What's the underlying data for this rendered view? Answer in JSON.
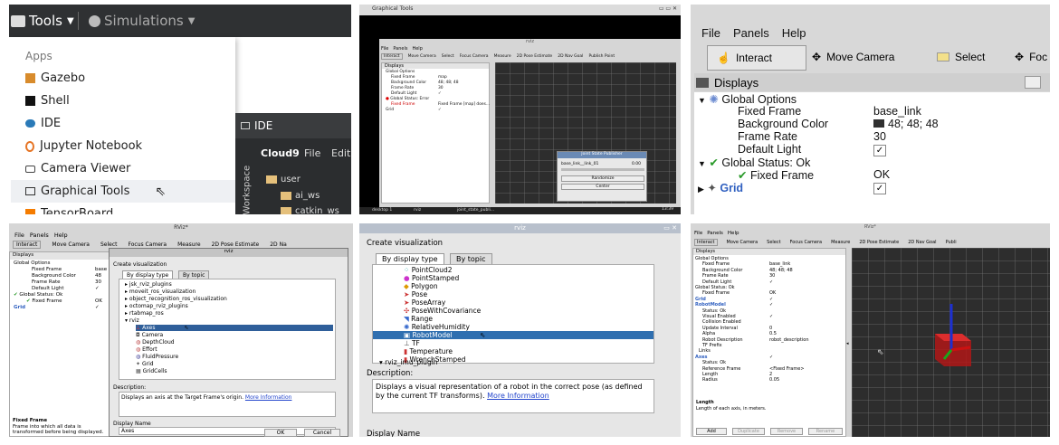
{
  "p1": {
    "tools_label": "Tools",
    "simulations_label": "Simulations",
    "apps_heading": "Apps",
    "menu_items": [
      "Gazebo",
      "Shell",
      "IDE",
      "Jupyter Notebook",
      "Camera Viewer",
      "Graphical Tools",
      "TensorBoard"
    ],
    "ide_title": "IDE",
    "cloud9_label": "Cloud9",
    "file_label": "File",
    "edit_label": "Edit",
    "workspace_label": "Workspace",
    "folders": [
      "user",
      "ai_ws",
      "catkin_ws"
    ]
  },
  "p2": {
    "window_title": "Graphical Tools",
    "rviz_title": "rviz",
    "menu": [
      "File",
      "Panels",
      "Help"
    ],
    "toolbar": [
      "Interact",
      "Move Camera",
      "Select",
      "Focus Camera",
      "Measure",
      "2D Pose Estimate",
      "2D Nav Goal",
      "Publish Point"
    ],
    "displays_label": "Displays",
    "tree": [
      {
        "label": "Global Options",
        "value": ""
      },
      {
        "label": "Fixed Frame",
        "value": "map"
      },
      {
        "label": "Background Color",
        "value": "48; 48; 48"
      },
      {
        "label": "Frame Rate",
        "value": "30"
      },
      {
        "label": "Default Light",
        "value": "✓"
      },
      {
        "label": "Global Status: Error",
        "value": ""
      },
      {
        "label": "Fixed Frame",
        "value": "Fixed Frame [map] does..."
      },
      {
        "label": "Grid",
        "value": "✓"
      }
    ],
    "jsp_title": "Joint State Publisher",
    "jsp_joint": "base_link__link_01",
    "jsp_value": "0.00",
    "randomize": "Randomize",
    "center": "Center",
    "taskbar": [
      "desktop 1",
      "rviz",
      "joint_state_publi..."
    ],
    "clock_time": "13:39",
    "clock_day": "Thursday 22"
  },
  "p3": {
    "menu": [
      "File",
      "Panels",
      "Help"
    ],
    "toolbar": [
      "Interact",
      "Move Camera",
      "Select",
      "Foc"
    ],
    "displays_label": "Displays",
    "rows": [
      {
        "label": "Global Options",
        "value": ""
      },
      {
        "label": "Fixed Frame",
        "value": "base_link"
      },
      {
        "label": "Background Color",
        "value": "48; 48; 48"
      },
      {
        "label": "Frame Rate",
        "value": "30"
      },
      {
        "label": "Default Light",
        "value": "✓"
      },
      {
        "label": "Global Status: Ok",
        "value": ""
      },
      {
        "label": "Fixed Frame",
        "value": "OK"
      },
      {
        "label": "Grid",
        "value": "✓"
      }
    ]
  },
  "p4": {
    "rviz_title": "RViz*",
    "menu": [
      "File",
      "Panels",
      "Help"
    ],
    "toolbar": [
      "Interact",
      "Move Camera",
      "Select",
      "Focus Camera",
      "Measure",
      "2D Pose Estimate",
      "2D Na"
    ],
    "displays_label": "Displays",
    "tree": [
      {
        "label": "Global Options",
        "value": ""
      },
      {
        "label": "Fixed Frame",
        "value": "base"
      },
      {
        "label": "Background Color",
        "value": "48"
      },
      {
        "label": "Frame Rate",
        "value": "30"
      },
      {
        "label": "Default Light",
        "value": "✓"
      },
      {
        "label": "Global Status: Ok",
        "value": ""
      },
      {
        "label": "Fixed Frame",
        "value": "OK"
      },
      {
        "label": "Grid",
        "value": "✓"
      }
    ],
    "dialog_title": "rviz",
    "dialog_heading": "Create visualization",
    "tabs": [
      "By display type",
      "By topic"
    ],
    "list": [
      "jsk_rviz_plugins",
      "moveit_ros_visualization",
      "object_recognition_ros_visualization",
      "octomap_rviz_plugins",
      "rtabmap_ros",
      "rviz",
      "Axes",
      "Camera",
      "DepthCloud",
      "Effort",
      "FluidPressure",
      "Grid",
      "GridCells"
    ],
    "description_label": "Description:",
    "description": "Displays an axis at the Target Frame's origin.",
    "more_info": "More Information",
    "display_name_label": "Display Name",
    "display_name_value": "Axes",
    "ok": "OK",
    "cancel": "Cancel",
    "fixed_frame_label": "Fixed Frame",
    "fixed_frame_desc": "Frame into which all data is transformed before being displayed."
  },
  "p5": {
    "title": "rviz",
    "heading": "Create visualization",
    "tabs": [
      "By display type",
      "By topic"
    ],
    "list": [
      "PointCloud2",
      "PointStamped",
      "Polygon",
      "Pose",
      "PoseArray",
      "PoseWithCovariance",
      "Range",
      "RelativeHumidity",
      "RobotModel",
      "TF",
      "Temperature",
      "WrenchStamped",
      "rviz_imu_plugin"
    ],
    "description_label": "Description:",
    "description": "Displays a visual representation of a robot in the correct pose (as defined by the current TF transforms).",
    "more_info": "More Information",
    "display_name_label": "Display Name"
  },
  "p6": {
    "title": "RViz*",
    "menu": [
      "File",
      "Panels",
      "Help"
    ],
    "toolbar": [
      "Interact",
      "Move Camera",
      "Select",
      "Focus Camera",
      "Measure",
      "2D Pose Estimate",
      "2D Nav Goal",
      "Publi"
    ],
    "displays_label": "Displays",
    "tree": [
      {
        "label": "Global Options",
        "value": ""
      },
      {
        "label": "Fixed Frame",
        "value": "base_link"
      },
      {
        "label": "Background Color",
        "value": "48; 48; 48"
      },
      {
        "label": "Frame Rate",
        "value": "30"
      },
      {
        "label": "Default Light",
        "value": "✓"
      },
      {
        "label": "Global Status: Ok",
        "value": ""
      },
      {
        "label": "Fixed Frame",
        "value": "OK"
      },
      {
        "label": "Grid",
        "value": "✓"
      },
      {
        "label": "RobotModel",
        "value": "✓"
      },
      {
        "label": "Status: Ok",
        "value": ""
      },
      {
        "label": "Visual Enabled",
        "value": "✓"
      },
      {
        "label": "Collision Enabled",
        "value": ""
      },
      {
        "label": "Update Interval",
        "value": "0"
      },
      {
        "label": "Alpha",
        "value": "0.5"
      },
      {
        "label": "Robot Description",
        "value": "robot_description"
      },
      {
        "label": "TF Prefix",
        "value": ""
      },
      {
        "label": "Links",
        "value": ""
      },
      {
        "label": "Axes",
        "value": "✓"
      },
      {
        "label": "Status: Ok",
        "value": ""
      },
      {
        "label": "Reference Frame",
        "value": "<Fixed Frame>"
      },
      {
        "label": "Length",
        "value": "2"
      },
      {
        "label": "Radius",
        "value": "0.05"
      }
    ],
    "length_label": "Length",
    "length_desc": "Length of each axis, in meters.",
    "buttons": [
      "Add",
      "Duplicate",
      "Remove",
      "Rename"
    ]
  }
}
